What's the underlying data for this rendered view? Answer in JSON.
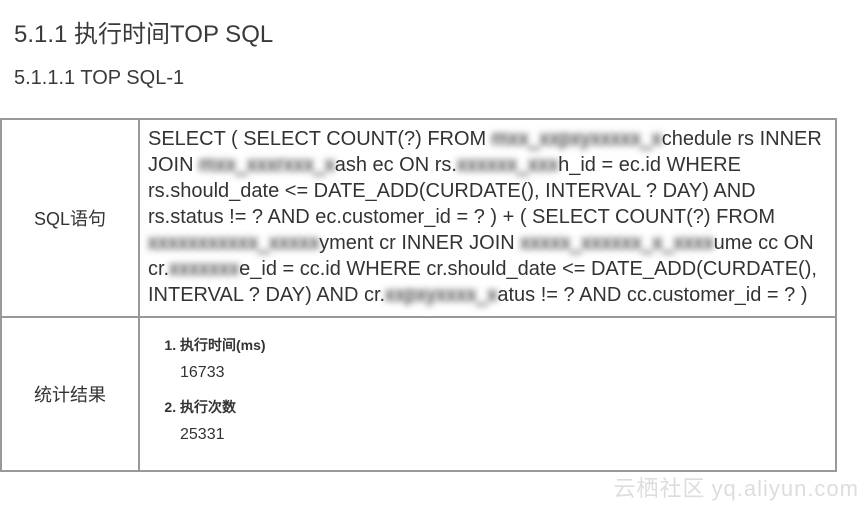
{
  "headings": {
    "section": "5.1.1 执行时间TOP SQL",
    "subsection": "5.1.1.1 TOP SQL-1"
  },
  "table": {
    "row_sql_label": "SQL语句",
    "row_stats_label": "统计结果"
  },
  "sql": {
    "p1": "SELECT ( SELECT COUNT(?) FROM ",
    "b1": "mxx_xxpxyxxxxx_x",
    "p2": "chedule rs INNER JOIN ",
    "b2": "mxx_xxxrxxx_x",
    "p3": "ash ec ON rs.",
    "b3": "xxxxxx_xxx",
    "p4": "h_id = ec.id WHERE rs.should_date <= DATE_ADD(CURDATE(), INTERVAL ? DAY) AND rs.status != ? AND ec.customer_id = ? ) + ( SELECT COUNT(?) FROM ",
    "b4": "xxxxxxxxxxx_xxxxx",
    "p5": "yment cr INNER JOIN ",
    "b5": "xxxxx_xxxxxx_x_xxxx",
    "p6": "ume cc ON cr.",
    "b6": "xxxxxxx",
    "p7": "e_id = cc.id WHERE cr.should_date <= DATE_ADD(CURDATE(), INTERVAL ? DAY) AND cr.",
    "b7": "xxpxyxxxx_x",
    "p8": "atus != ? AND cc.customer_id = ? )"
  },
  "stats": {
    "item1_label": "执行时间(ms)",
    "item1_value": "16733",
    "item2_label": "执行次数",
    "item2_value": "25331"
  },
  "watermark": {
    "cn": "云栖社区",
    "en": "yq.aliyun.com"
  }
}
